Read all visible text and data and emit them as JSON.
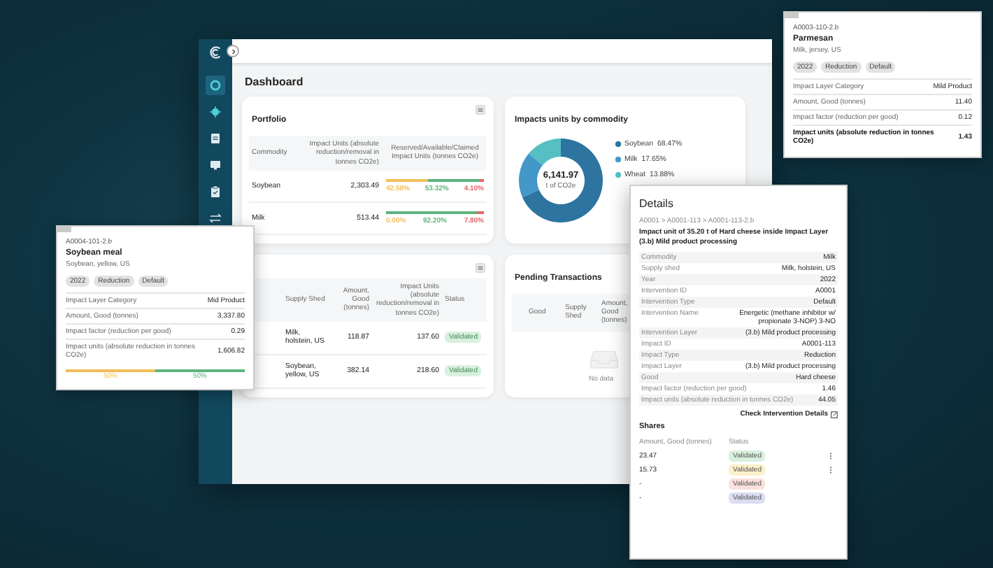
{
  "sidebar": {
    "items": [
      {
        "selected": true
      },
      {
        "selected": false
      },
      {
        "selected": false
      },
      {
        "selected": false
      },
      {
        "selected": false
      },
      {
        "selected": false
      }
    ]
  },
  "page_title": "Dashboard",
  "portfolio": {
    "title": "Portfolio",
    "columns": [
      "Commodity",
      "Impact Units (absolute reduction/removal in tonnes CO2e)",
      "Reserved/Available/Claimed Impact Units (tonnes CO2e)"
    ],
    "rows": [
      {
        "commodity": "Soybean",
        "impact_units": "2,303.49",
        "segments": [
          {
            "level": 0.4258,
            "label": "42.58%",
            "color": "#f2bd5a"
          },
          {
            "level": 0.5332,
            "label": "53.32%",
            "color": "#5db37e"
          },
          {
            "level": 0.041,
            "label": "4.10%",
            "color": "#e5646a"
          }
        ]
      },
      {
        "commodity": "Milk",
        "impact_units": "513.44",
        "segments": [
          {
            "level": 0.0,
            "label": "0.00%",
            "color": "#f2bd5a"
          },
          {
            "level": 0.922,
            "label": "92.20%",
            "color": "#5db37e"
          },
          {
            "level": 0.078,
            "label": "7.80%",
            "color": "#e5646a"
          }
        ]
      }
    ]
  },
  "impacts": {
    "title": "Impacts units by commodity",
    "total": "6,141.97",
    "unit": "t of CO2e",
    "legend": [
      {
        "label": "68.47%",
        "color": "#2e74a0"
      },
      {
        "label": "17.65%",
        "color": "#4397c9"
      },
      {
        "label": "13.88%",
        "color": "#56bfc4"
      }
    ],
    "chart_data": {
      "type": "donut",
      "categories": [
        "Soybean",
        "Milk",
        "Wheat"
      ],
      "values": [
        68.47,
        17.65,
        13.88
      ]
    }
  },
  "transactions": {
    "columns": [
      "Supply Shed",
      "Amount, Good (tonnes)",
      "Impact Units (absolute reduction/removal in tonnes CO2e)",
      "Status"
    ],
    "rows": [
      {
        "supply_shed": "Milk, holstein, US",
        "amount": "118.87",
        "impact_units": "137.60",
        "status": "Validated"
      },
      {
        "supply_shed": "Soybean, yellow, US",
        "amount": "382.14",
        "impact_units": "218.60",
        "status": "Validated"
      }
    ]
  },
  "pending": {
    "title": "Pending Transactions",
    "columns": [
      "Good",
      "Supply Shed",
      "Amount, Good (tonnes)"
    ],
    "empty_text": "No data"
  },
  "tooltips": [
    {
      "id": "A0003-110-2.b",
      "title": "Parmesan",
      "subtitle": "Milk, jersey, US",
      "chips": [
        "2022",
        "Reduction",
        "Default"
      ],
      "rows": [
        {
          "label": "Impact Layer Category",
          "value": "Mild Product",
          "bold": false
        },
        {
          "label": "Amount, Good (tonnes)",
          "value": "11.40",
          "bold": false
        },
        {
          "label": "Impact factor (reduction per good)",
          "value": "0.12",
          "bold": false
        },
        {
          "label": "Impact units (absolute reduction in tonnes CO2e)",
          "value": "1.43",
          "bold": true
        }
      ]
    },
    {
      "id": "A0004-101-2.b",
      "title": "Soybean meal",
      "subtitle": "Soybean, yellow, US",
      "chips": [
        "2022",
        "Reduction",
        "Default"
      ],
      "rows": [
        {
          "label": "Impact Layer Category",
          "value": "Mid Product",
          "bold": false
        },
        {
          "label": "Amount, Good (tonnes)",
          "value": "3,337.80",
          "bold": false
        },
        {
          "label": "Impact factor (reduction per good)",
          "value": "0.29",
          "bold": false
        },
        {
          "label": "Impact units (absolute reduction in tonnes CO2e)",
          "value": "1,606.82",
          "bold": false
        }
      ],
      "segments": [
        {
          "level": 0.5,
          "label": "50%",
          "color": "#f2bd5a"
        },
        {
          "level": 0.5,
          "label": "50%",
          "color": "#5db37e"
        }
      ]
    }
  ],
  "details": {
    "title": "Details",
    "breadcrumb": "A0001 > A0001-113 > A0001-113-2.b",
    "summary": "Impact unit of 35.20 t of Hard cheese inside Impact Layer (3.b) Mild product processing",
    "rows": [
      {
        "label": "Commodity",
        "value": "Milk"
      },
      {
        "label": "Supply shed",
        "value": "Milk, holstein, US"
      },
      {
        "label": "Year",
        "value": "2022"
      },
      {
        "label": "Intervention ID",
        "value": "A0001"
      },
      {
        "label": "Intervention Type",
        "value": "Default"
      },
      {
        "label": "Intervention Name",
        "value": "Energetic (methane inhibitor w/ propionate 3-NOP) 3-NO"
      },
      {
        "label": "Intervention Layer",
        "value": "(3.b) Mild product processing"
      },
      {
        "label": "Impact ID",
        "value": "A0001-113"
      },
      {
        "label": "Impact Type",
        "value": "Reduction"
      },
      {
        "label": "Impact Layer",
        "value": "(3.b) Mild product processing"
      },
      {
        "label": "Good",
        "value": "Hard cheese"
      },
      {
        "label": "Impact factor (reduction per good)",
        "value": "1.46"
      },
      {
        "label": "Impact units (absolute reduction in tonnes CO2e)",
        "value": "44.05"
      }
    ],
    "link": "Check Intervention Details",
    "shares_title": "Shares",
    "shares_columns": [
      "Amount, Good (tonnes)",
      "Status"
    ],
    "shares": [
      {
        "amount": "23.47",
        "status": "Validated",
        "color": "#d9f0df",
        "menu": true
      },
      {
        "amount": "15.73",
        "status": "Validated",
        "color": "#fbf0c9",
        "menu": true
      },
      {
        "amount": "-",
        "status": "Validated",
        "color": "#fbe0dc",
        "menu": false
      },
      {
        "amount": "-",
        "status": "Validated",
        "color": "#dcdcf2",
        "menu": false
      }
    ]
  }
}
